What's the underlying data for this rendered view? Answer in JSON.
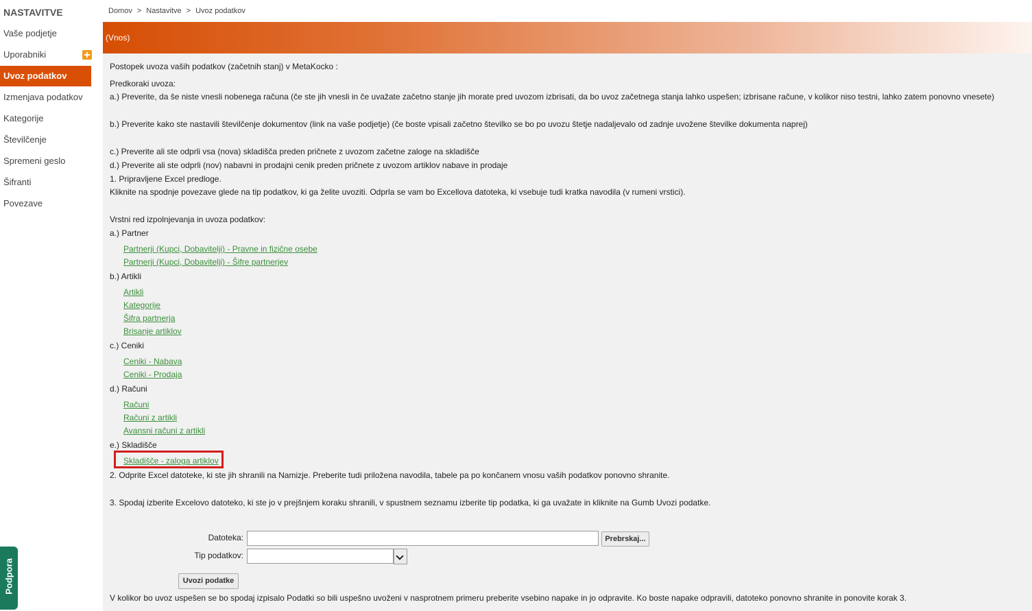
{
  "sidebar": {
    "title": "NASTAVITVE",
    "items": [
      {
        "label": "Vaše podjetje"
      },
      {
        "label": "Uporabniki"
      },
      {
        "label": "Uvoz podatkov"
      },
      {
        "label": "Izmenjava podatkov"
      },
      {
        "label": "Kategorije"
      },
      {
        "label": "Številčenje"
      },
      {
        "label": "Spremeni geslo"
      },
      {
        "label": "Šifranti"
      },
      {
        "label": "Povezave"
      }
    ],
    "active_item": "Uvoz podatkov",
    "support_label": "Podpora"
  },
  "breadcrumb": {
    "home": "Domov",
    "settings": "Nastavitve",
    "current": "Uvoz podatkov",
    "separator": ">"
  },
  "header": {
    "title": "(Vnos)"
  },
  "content": {
    "intro": "Postopek uvoza vaših podatkov (začetnih stanj) v MetaKocko :",
    "pre_title": "Predkoraki uvoza:",
    "pre_a": "a.) Preverite, da še niste vnesli nobenega računa (če ste jih vnesli in če uvažate začetno stanje jih morate pred uvozom izbrisati, da bo uvoz začetnega stanja lahko uspešen; izbrisane račune, v kolikor niso testni, lahko zatem ponovno vnesete)",
    "pre_b": "b.) Preverite kako ste nastavili številčenje dokumentov (link na vaše podjetje) (če boste vpisali začetno številko se bo po uvozu štetje nadaljevalo od zadnje uvožene številke dokumenta naprej)",
    "pre_c": "c.) Preverite ali ste odprli vsa (nova) skladišča preden pričnete z uvozom začetne zaloge na skladišče",
    "pre_d": "d.) Preverite ali ste odprli (nov) nabavni in prodajni cenik preden pričnete z uvozom artiklov nabave in prodaje",
    "step1": "1. Pripravljene Excel predloge.",
    "step1_desc": "Kliknite na spodnje povezave glede na tip podatkov, ki ga želite uvoziti. Odprla se vam bo Excellova datoteka, ki vsebuje tudi kratka navodila (v rumeni vrstici).",
    "order_title": "Vrstni red izpolnjevanja in uvoza podatkov:",
    "groups": [
      {
        "label": "a.) Partner",
        "links": [
          "Partnerji (Kupci, Dobavitelji) - Pravne in fizične osebe",
          "Partnerji (Kupci, Dobavitelji) - Šifre partnerjev"
        ]
      },
      {
        "label": "b.) Artikli",
        "links": [
          "Artikli",
          "Kategorije",
          "Šifra partnerja",
          "Brisanje artiklov"
        ]
      },
      {
        "label": "c.) Ceniki",
        "links": [
          "Ceniki - Nabava",
          "Ceniki - Prodaja"
        ]
      },
      {
        "label": "d.) Računi",
        "links": [
          "Računi",
          "Računi z artikli",
          "Avansni računi z artikli"
        ]
      },
      {
        "label": "e.) Skladišče",
        "links": [
          "Skladišče - zaloga artiklov"
        ]
      }
    ],
    "step2": "2. Odprite Excel datoteke, ki ste jih shranili na Namizje. Preberite tudi priložena navodila, tabele pa po končanem vnosu vaših podatkov ponovno shranite.",
    "step3": "3. Spodaj izberite Excelovo datoteko, ki ste jo v prejšnjem koraku shranili, v spustnem seznamu izberite tip podatka, ki ga uvažate in kliknite na Gumb Uvozi podatke.",
    "footer_note": "V kolikor bo uvoz uspešen se bo spodaj izpisalo Podatki so bili uspešno uvoženi v nasprotnem primeru preberite vsebino napake in jo odpravite. Ko boste napake odpravili, datoteko ponovno shranite in ponovite korak 3."
  },
  "form": {
    "file_label": "Datoteka:",
    "file_value": "",
    "browse_label": "Prebrskaj...",
    "type_label": "Tip podatkov:",
    "type_value": "",
    "import_label": "Uvozi podatke"
  },
  "colors": {
    "accent": "#d94f06",
    "link": "#3b8f3b",
    "highlight": "#d41d1d",
    "support": "#1b7a5c"
  }
}
